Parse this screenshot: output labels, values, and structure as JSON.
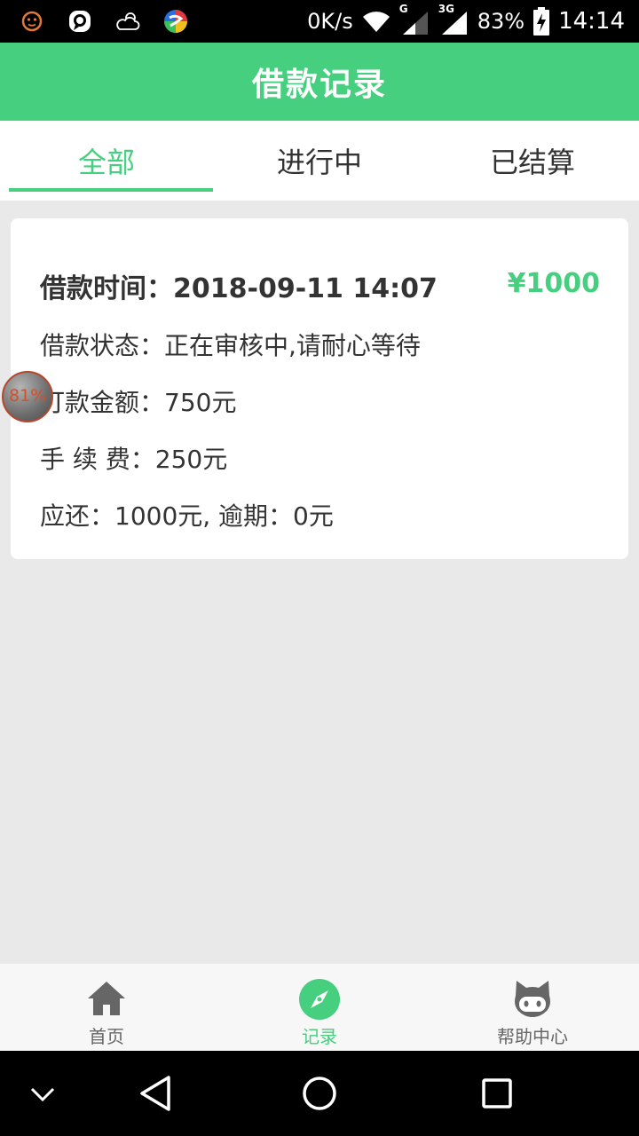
{
  "status_bar": {
    "net_speed": "0K/s",
    "net_g": "G",
    "net_3g": "3G",
    "battery": "83%",
    "time": "14:14"
  },
  "header": {
    "title": "借款记录"
  },
  "tabs": [
    {
      "label": "全部",
      "active": true
    },
    {
      "label": "进行中",
      "active": false
    },
    {
      "label": "已结算",
      "active": false
    }
  ],
  "record": {
    "time_label": "借款时间：2018-09-11 14:07",
    "amount": "¥1000",
    "status": "借款状态：正在审核中,请耐心等待",
    "payout": "打款金额：750元",
    "fee": "手 续 费：250元",
    "repay": "应还：1000元, 逾期：0元"
  },
  "float_badge": {
    "percent": "81%"
  },
  "bottom_nav": [
    {
      "label": "首页",
      "icon": "home-icon"
    },
    {
      "label": "记录",
      "icon": "compass-icon",
      "active": true
    },
    {
      "label": "帮助中心",
      "icon": "cat-icon"
    }
  ],
  "colors": {
    "accent": "#45cf7e",
    "background": "#e9e9e9"
  }
}
